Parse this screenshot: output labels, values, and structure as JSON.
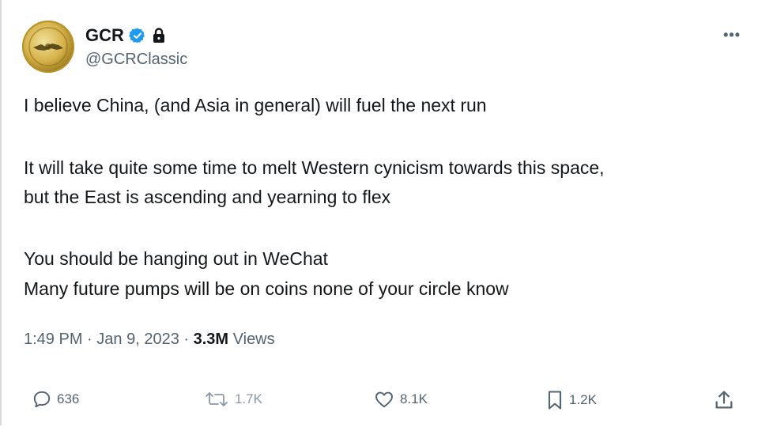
{
  "author": {
    "display_name": "GCR",
    "handle": "@GCRClassic"
  },
  "menu": {
    "more_label": "•••"
  },
  "tweet": {
    "lines": [
      "I believe China, (and Asia in general) will fuel the next run",
      "It will take quite some time to melt Western cynicism towards this space,",
      "but the East is ascending and yearning to flex",
      "You should be hanging out in WeChat",
      "Many future pumps will be on coins none of your circle know"
    ],
    "time": "1:49 PM",
    "date": "Jan 9, 2023",
    "views_count": "3.3M",
    "views_label": "Views",
    "separator": "·"
  },
  "actions": {
    "replies": "636",
    "reposts": "1.7K",
    "likes": "8.1K",
    "bookmarks": "1.2K"
  },
  "colors": {
    "verified": "#1d9bf0",
    "text": "#14171a",
    "muted": "#536471"
  }
}
